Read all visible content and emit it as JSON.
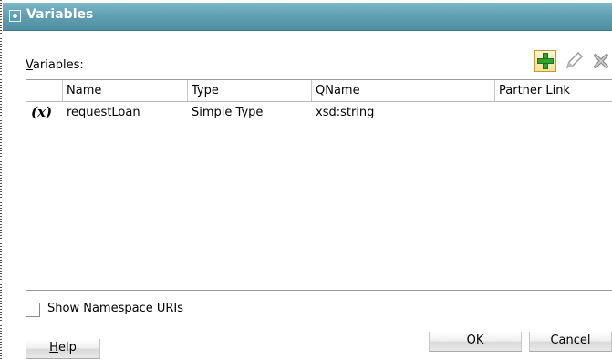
{
  "window": {
    "title": "Variables"
  },
  "variables_label": {
    "mnemonic": "V",
    "rest": "ariables:"
  },
  "toolbar": {
    "add_icon": "add-plus-icon",
    "edit_icon": "pencil-icon",
    "delete_icon": "delete-x-icon"
  },
  "table": {
    "columns": [
      "",
      "Name",
      "Type",
      "QName",
      "Partner Link"
    ],
    "rows": [
      {
        "icon": "(x)",
        "name": "requestLoan",
        "type": "Simple Type",
        "qname": "xsd:string",
        "partner_link": ""
      }
    ]
  },
  "show_namespace": {
    "mnemonic": "S",
    "rest": "how Namespace URIs",
    "checked": false
  },
  "buttons": {
    "help": {
      "mnemonic": "H",
      "rest": "elp"
    },
    "ok": "OK",
    "cancel": "Cancel"
  }
}
